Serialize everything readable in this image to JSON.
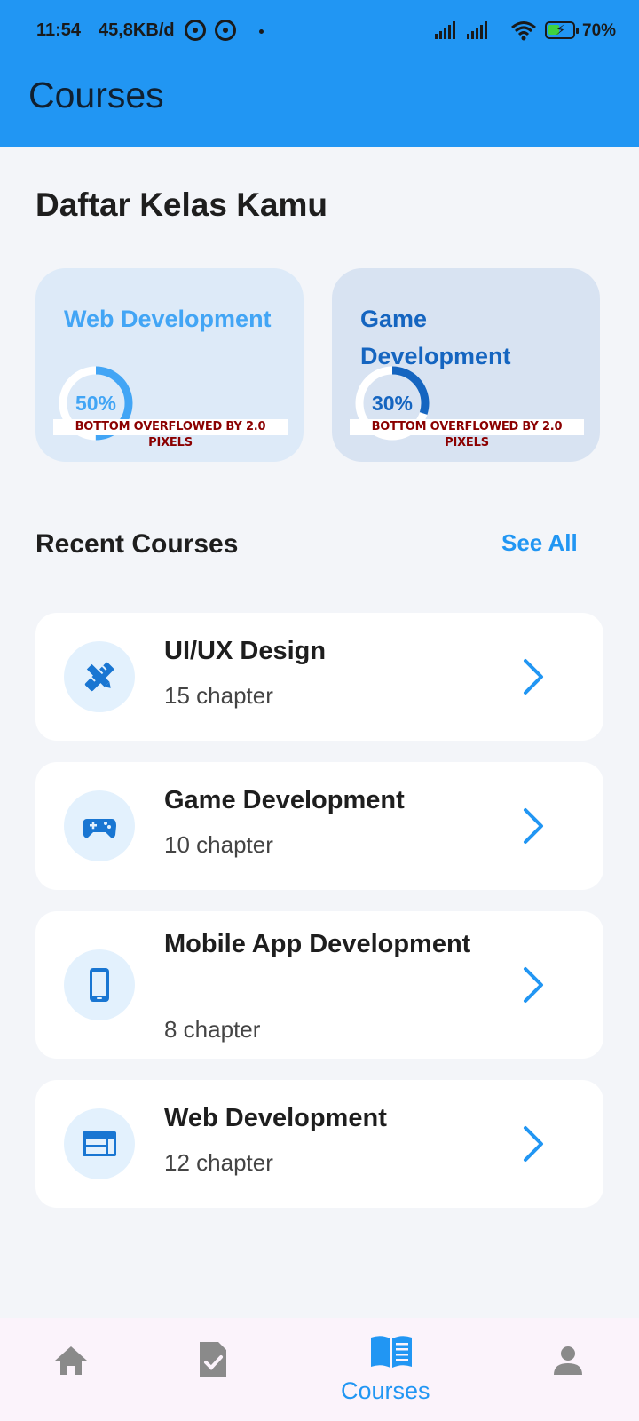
{
  "status_bar": {
    "time": "11:54",
    "speed": "45,8KB/d",
    "battery": "70%"
  },
  "app_bar": {
    "title": "Courses"
  },
  "main": {
    "title": "Daftar Kelas Kamu",
    "progress_cards": [
      {
        "title": "Web Development",
        "percent_label": "50%",
        "progress": 0.5,
        "color": "#42A5F5",
        "overflow": "BOTTOM OVERFLOWED BY 2.0 PIXELS"
      },
      {
        "title": "Game Development",
        "percent_label": "30%",
        "progress": 0.3,
        "color": "#1565C0",
        "overflow": "BOTTOM OVERFLOWED BY 2.0 PIXELS"
      }
    ],
    "recent": {
      "title": "Recent Courses",
      "see_all": "See All",
      "courses": [
        {
          "name": "UI/UX Design",
          "chapters": "15 chapter",
          "icon": "design-tools-icon"
        },
        {
          "name": "Game Development",
          "chapters": "10 chapter",
          "icon": "gamepad-icon"
        },
        {
          "name": "Mobile App Development",
          "chapters": "8 chapter",
          "icon": "smartphone-icon"
        },
        {
          "name": "Web Development",
          "chapters": "12 chapter",
          "icon": "web-window-icon"
        }
      ]
    }
  },
  "bottom_nav": {
    "items": [
      {
        "icon": "home-icon"
      },
      {
        "icon": "assignment-check-icon"
      },
      {
        "icon": "book-icon",
        "label": "Courses",
        "active": true
      },
      {
        "icon": "person-icon"
      }
    ]
  },
  "colors": {
    "primary": "#2196F3",
    "background": "#F3F5F9",
    "overflow_text": "#8B0000"
  }
}
